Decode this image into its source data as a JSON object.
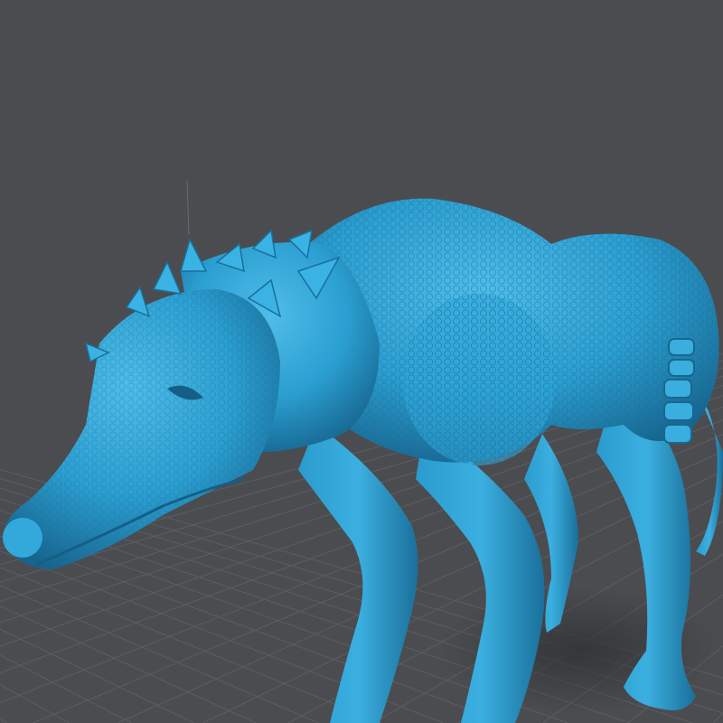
{
  "viewport": {
    "background_color": "#4b4c50",
    "grid_color": "#5c5d62",
    "model_color": "#2b9fd1",
    "model_shadow_color": "#155f86",
    "model_highlight_color": "#5cc4ee"
  }
}
